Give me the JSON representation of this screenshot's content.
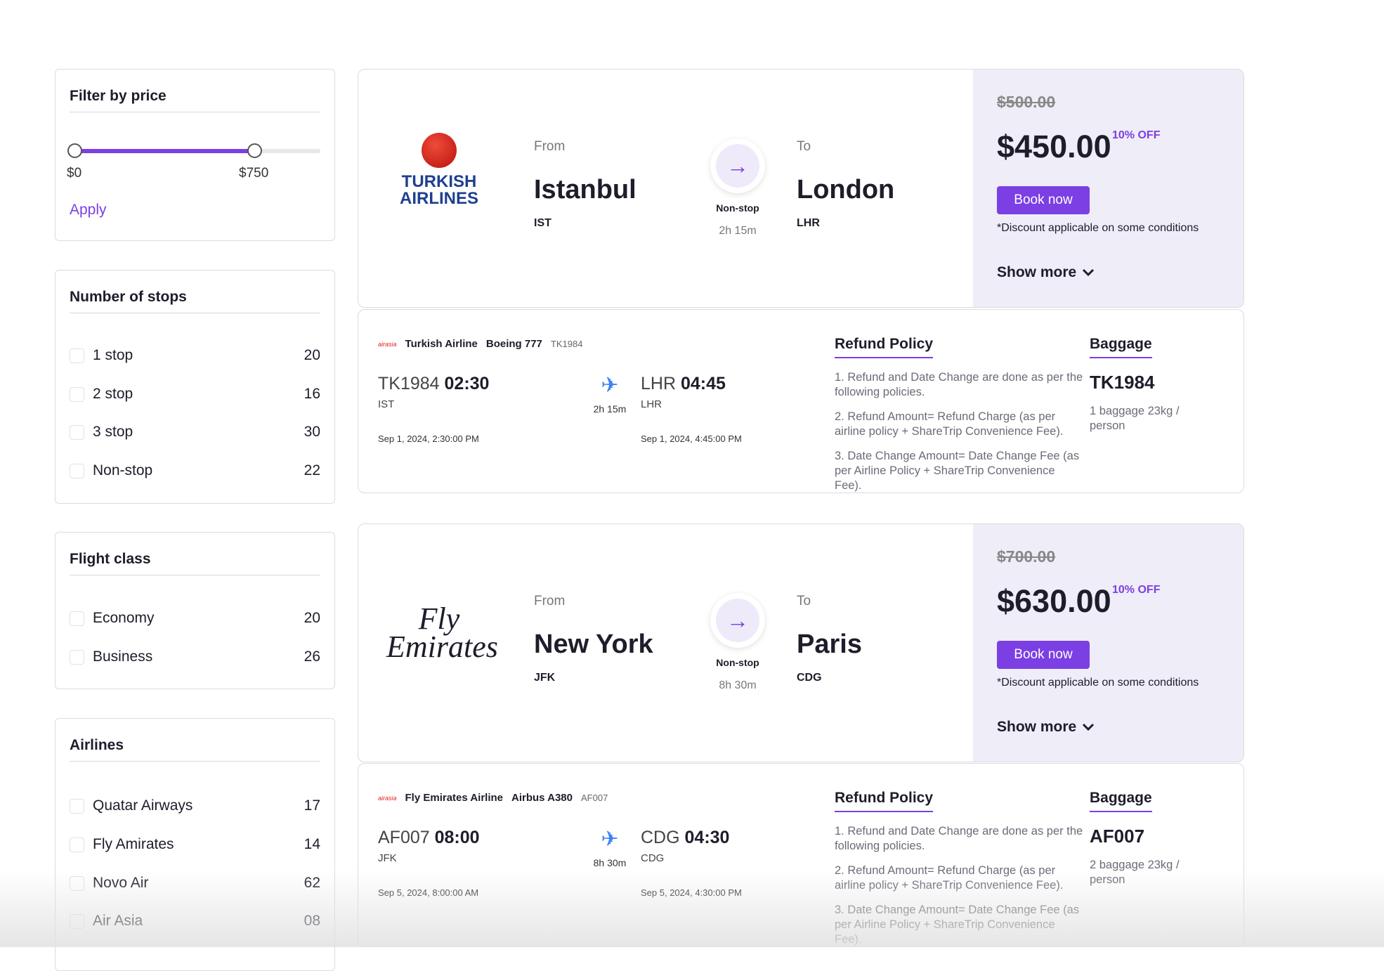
{
  "sidebar": {
    "price": {
      "title": "Filter by price",
      "min_label": "$0",
      "max_label": "$750",
      "min_value": 0,
      "max_value": 750,
      "apply": "Apply"
    },
    "stops": {
      "title": "Number of stops",
      "items": [
        {
          "label": "1 stop",
          "count": "20"
        },
        {
          "label": "2 stop",
          "count": "16"
        },
        {
          "label": "3 stop",
          "count": "30"
        },
        {
          "label": "Non-stop",
          "count": "22"
        }
      ]
    },
    "class": {
      "title": "Flight class",
      "items": [
        {
          "label": "Economy",
          "count": "20"
        },
        {
          "label": "Business",
          "count": "26"
        }
      ]
    },
    "airlines": {
      "title": "Airlines",
      "items": [
        {
          "label": "Quatar Airways",
          "count": "17"
        },
        {
          "label": "Fly Amirates",
          "count": "14"
        },
        {
          "label": "Novo Air",
          "count": "62"
        },
        {
          "label": "Air Asia",
          "count": "08"
        }
      ]
    }
  },
  "flights": [
    {
      "logo": "TURKISH AIRLINES",
      "from_label": "From",
      "from_city": "Istanbul",
      "from_code": "IST",
      "to_label": "To",
      "to_city": "London",
      "to_code": "LHR",
      "stops": "Non-stop",
      "duration": "2h 15m",
      "old_price": "$500.00",
      "price": "$450.00",
      "discount": "10% OFF",
      "book": "Book now",
      "note": "*Discount applicable on some conditions",
      "show_more": "Show more",
      "details": {
        "small_logo": "airasia",
        "airline": "Turkish Airline",
        "aircraft": "Boeing 777",
        "code": "TK1984",
        "dep_code": "TK1984",
        "dep_time": "02:30",
        "dep_airport": "IST",
        "dep_date": "Sep 1, 2024, 2:30:00 PM",
        "duration": "2h 15m",
        "arr_code": "LHR",
        "arr_time": "04:45",
        "arr_airport": "LHR",
        "arr_date": "Sep 1, 2024, 4:45:00 PM",
        "refund_title": "Refund Policy",
        "policies": [
          "1. Refund and Date Change are done as per the following policies.",
          "2. Refund Amount= Refund Charge (as per airline policy + ShareTrip Convenience Fee).",
          "3. Date Change Amount= Date Change Fee (as per Airline Policy + ShareTrip Convenience Fee)."
        ],
        "baggage_title": "Baggage",
        "baggage_code": "TK1984",
        "baggage": "1 baggage 23kg / person"
      }
    },
    {
      "logo": "Fly Emirates",
      "from_label": "From",
      "from_city": "New York",
      "from_code": "JFK",
      "to_label": "To",
      "to_city": "Paris",
      "to_code": "CDG",
      "stops": "Non-stop",
      "duration": "8h 30m",
      "old_price": "$700.00",
      "price": "$630.00",
      "discount": "10% OFF",
      "book": "Book now",
      "note": "*Discount applicable on some conditions",
      "show_more": "Show more",
      "details": {
        "small_logo": "airasia",
        "airline": "Fly Emirates Airline",
        "aircraft": "Airbus A380",
        "code": "AF007",
        "dep_code": "AF007",
        "dep_time": "08:00",
        "dep_airport": "JFK",
        "dep_date": "Sep 5, 2024, 8:00:00 AM",
        "duration": "8h 30m",
        "arr_code": "CDG",
        "arr_time": "04:30",
        "arr_airport": "CDG",
        "arr_date": "Sep 5, 2024, 4:30:00 PM",
        "refund_title": "Refund Policy",
        "policies": [
          "1. Refund and Date Change are done as per the following policies.",
          "2. Refund Amount= Refund Charge (as per airline policy + ShareTrip Convenience Fee).",
          "3. Date Change Amount= Date Change Fee (as per Airline Policy + ShareTrip Convenience Fee)."
        ],
        "baggage_title": "Baggage",
        "baggage_code": "AF007",
        "baggage": "2 baggage 23kg / person"
      }
    }
  ],
  "colors": {
    "accent": "#7b3fe4",
    "price_panel": "#efedf7",
    "plane": "#3b82f6"
  }
}
